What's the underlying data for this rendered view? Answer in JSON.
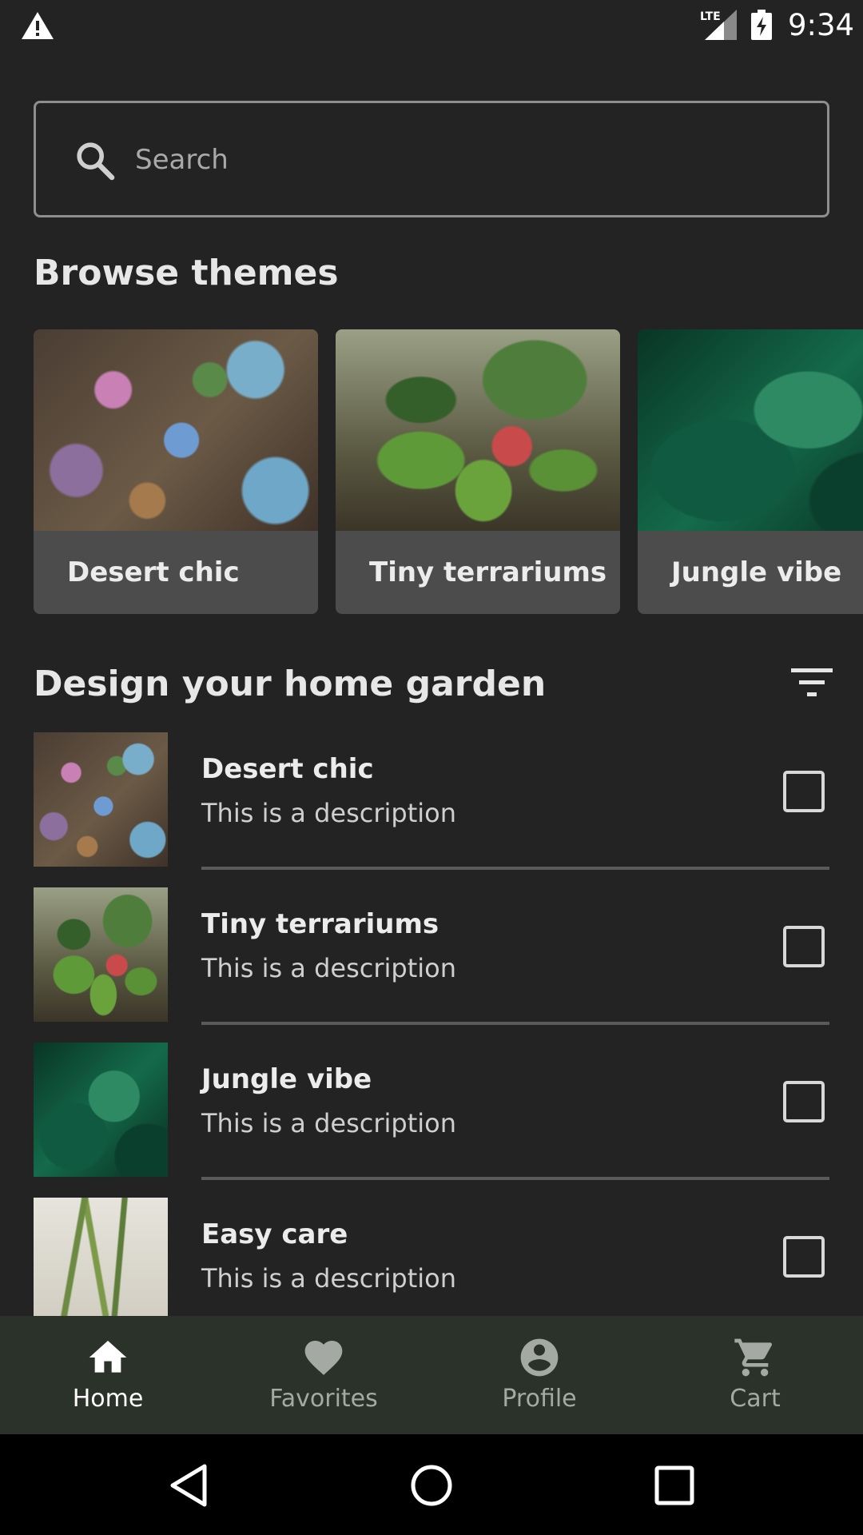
{
  "status_bar": {
    "time": "9:34",
    "network": "LTE",
    "icons": [
      "warning-icon",
      "signal-icon",
      "battery-charging-icon"
    ]
  },
  "search": {
    "placeholder": "Search",
    "icon": "search-icon"
  },
  "browse": {
    "title": "Browse themes",
    "themes": [
      {
        "label": "Desert chic"
      },
      {
        "label": "Tiny terrariums"
      },
      {
        "label": "Jungle vibe"
      }
    ]
  },
  "design": {
    "title": "Design your home garden",
    "filter_icon": "filter-icon",
    "items": [
      {
        "title": "Desert chic",
        "description": "This is a description",
        "checked": false
      },
      {
        "title": "Tiny terrariums",
        "description": "This is a description",
        "checked": false
      },
      {
        "title": "Jungle vibe",
        "description": "This is a description",
        "checked": false
      },
      {
        "title": "Easy care",
        "description": "This is a description",
        "checked": false
      }
    ]
  },
  "bottom_nav": {
    "items": [
      {
        "label": "Home",
        "icon": "home-icon",
        "active": true
      },
      {
        "label": "Favorites",
        "icon": "heart-icon",
        "active": false
      },
      {
        "label": "Profile",
        "icon": "account-circle-icon",
        "active": false
      },
      {
        "label": "Cart",
        "icon": "cart-icon",
        "active": false
      }
    ]
  },
  "system_nav": {
    "icons": [
      "back-icon",
      "home-circle-icon",
      "recents-icon"
    ]
  },
  "colors": {
    "background": "#232323",
    "card_label_bg": "#4c4c4c",
    "bottom_nav_bg": "#2b3229",
    "nav_inactive": "#a5a9a3",
    "nav_active": "#ffffff"
  }
}
